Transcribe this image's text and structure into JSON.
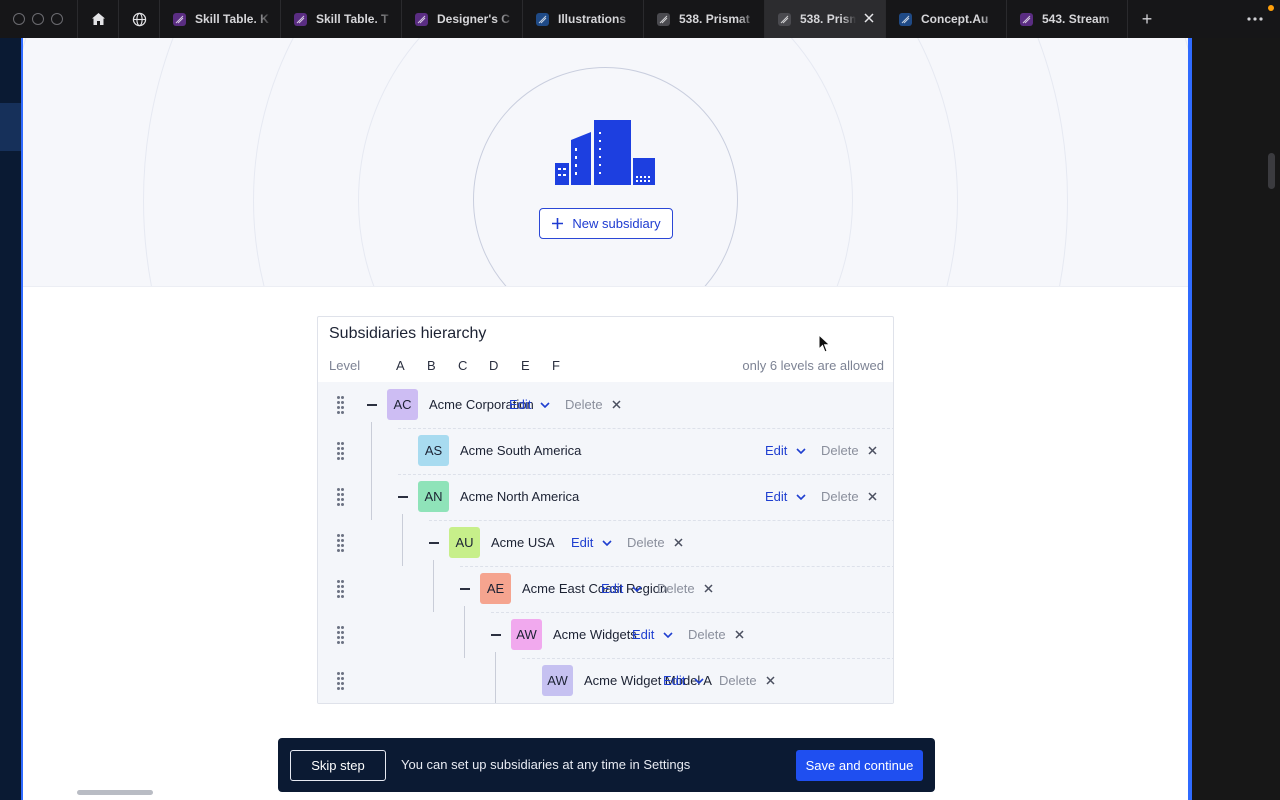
{
  "browser": {
    "tabs": [
      {
        "title": "Skill Table. K",
        "favicon": "purple-app-icon"
      },
      {
        "title": "Skill Table. T",
        "favicon": "purple-app-icon"
      },
      {
        "title": "Designer's C",
        "favicon": "purple-app-icon"
      },
      {
        "title": "Illustrations",
        "favicon": "blue-app-icon"
      },
      {
        "title": "538. Prismat",
        "favicon": "grey-app-icon"
      },
      {
        "title": "538. Prism",
        "favicon": "grey-app-icon",
        "active": true
      },
      {
        "title": "Concept.Au",
        "favicon": "blue-app-icon"
      },
      {
        "title": "543. Stream",
        "favicon": "purple-app-icon"
      }
    ],
    "new_tab_label": "+"
  },
  "hero": {
    "new_subsidiary_label": "New subsidiary",
    "illustration": "buildings-icon",
    "brand_color": "#1d3fe0"
  },
  "hierarchy": {
    "title": "Subsidiaries hierarchy",
    "level_label": "Level",
    "levels": [
      "A",
      "B",
      "C",
      "D",
      "E",
      "F"
    ],
    "levels_note": "only 6 levels are allowed",
    "edit_label": "Edit",
    "delete_label": "Delete",
    "rows": [
      {
        "initials": "AC",
        "name": "Acme Corporation",
        "depth": 0,
        "color": "#cdbdf3",
        "expanded": true
      },
      {
        "initials": "AS",
        "name": "Acme South America",
        "depth": 1,
        "color": "#a8dbf0",
        "expanded": false
      },
      {
        "initials": "AN",
        "name": "Acme North America",
        "depth": 1,
        "color": "#8fe3b9",
        "expanded": true
      },
      {
        "initials": "AU",
        "name": "Acme USA",
        "depth": 2,
        "color": "#c7ef8a",
        "expanded": true
      },
      {
        "initials": "AE",
        "name": "Acme East Coast Region",
        "depth": 3,
        "color": "#f5a48f",
        "expanded": true
      },
      {
        "initials": "AW",
        "name": "Acme Widgets",
        "depth": 4,
        "color": "#f1a9ee",
        "expanded": true
      },
      {
        "initials": "AW",
        "name": "Acme Widget Model A",
        "depth": 5,
        "color": "#c6c1f1",
        "expanded": false
      }
    ]
  },
  "footer": {
    "skip_label": "Skip step",
    "message": "You can set up subsidiaries at any time in Settings",
    "save_label": "Save and continue"
  }
}
